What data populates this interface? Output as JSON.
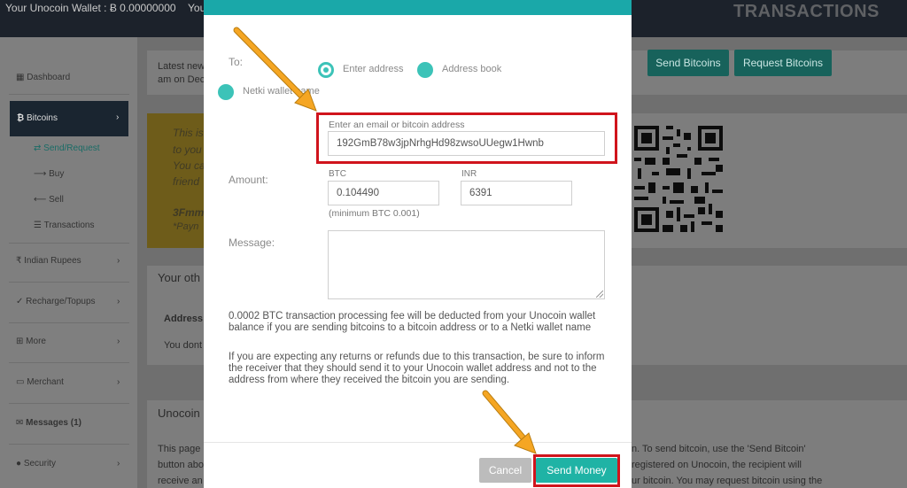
{
  "header": {
    "wallet_text": "Your Unocoin Wallet : Ƀ 0.00000000",
    "wallet_text_2": "You",
    "page_title": "TRANSACTIONS"
  },
  "sidebar": {
    "items": [
      {
        "label": "Dashboard",
        "icon": "grid-icon"
      },
      {
        "label": "Bitcoins",
        "icon": "bitcoin-icon"
      },
      {
        "label": "Indian Rupees",
        "icon": "rupee-icon"
      },
      {
        "label": "Recharge/Topups",
        "icon": "bolt-icon"
      },
      {
        "label": "More",
        "icon": "plus-square-icon"
      },
      {
        "label": "Merchant",
        "icon": "card-icon"
      },
      {
        "label": "Messages (1)",
        "icon": "envelope-icon"
      },
      {
        "label": "Security",
        "icon": "lock-icon"
      }
    ],
    "subitems": [
      {
        "label": "Send/Request",
        "icon": "exchange-icon"
      },
      {
        "label": "Buy",
        "icon": "arrow-right-icon"
      },
      {
        "label": "Sell",
        "icon": "arrow-left-icon"
      },
      {
        "label": "Transactions",
        "icon": "list-icon"
      }
    ]
  },
  "background": {
    "latest_news_1": "Latest new",
    "latest_news_2": "am on Dec",
    "send_bitcoins": "Send Bitcoins",
    "request_bitcoins": "Request Bitcoins",
    "yellow_lines": [
      "This is",
      "to you",
      "You ca",
      "friend"
    ],
    "address_fragment": "3Fmm",
    "pay_fragment": "*Payn",
    "your_other": "Your oth",
    "address_header": "Address",
    "you_dont": "You dont",
    "unocoin": "Unocoin",
    "body_left": [
      "This page",
      "button abo",
      "receive an"
    ],
    "body_right": [
      "n. To send bitcoin, use the 'Send Bitcoin'",
      "registered on Unocoin, the recipient will",
      "ur bitcoin. You may request bitcoin using the"
    ]
  },
  "modal": {
    "to_label": "To:",
    "options": [
      "Enter address",
      "Address book",
      "Netki wallet name"
    ],
    "address_label": "Enter an email or bitcoin address",
    "address_value": "192GmB78w3jpNrhgHd98zwsoUUegw1Hwnb",
    "amount_label": "Amount:",
    "btc_label": "BTC",
    "btc_value": "0.104490",
    "inr_label": "INR",
    "inr_value": "6391",
    "minimum_note": "(minimum BTC 0.001)",
    "message_label": "Message:",
    "fee_note": "0.0002 BTC transaction processing fee will be deducted from your Unocoin wallet balance if you are sending bitcoins to a bitcoin address or to a Netki wallet name",
    "refund_note": "If you are expecting any returns or refunds due to this transaction, be sure to inform the receiver that they should send it to your Unocoin wallet address and not to the address from where they received the bitcoin you are sending.",
    "cancel_label": "Cancel",
    "send_label": "Send Money"
  },
  "colors": {
    "accent": "#1fb3a5",
    "highlight": "#d0141c",
    "arrow": "#f5a623"
  }
}
